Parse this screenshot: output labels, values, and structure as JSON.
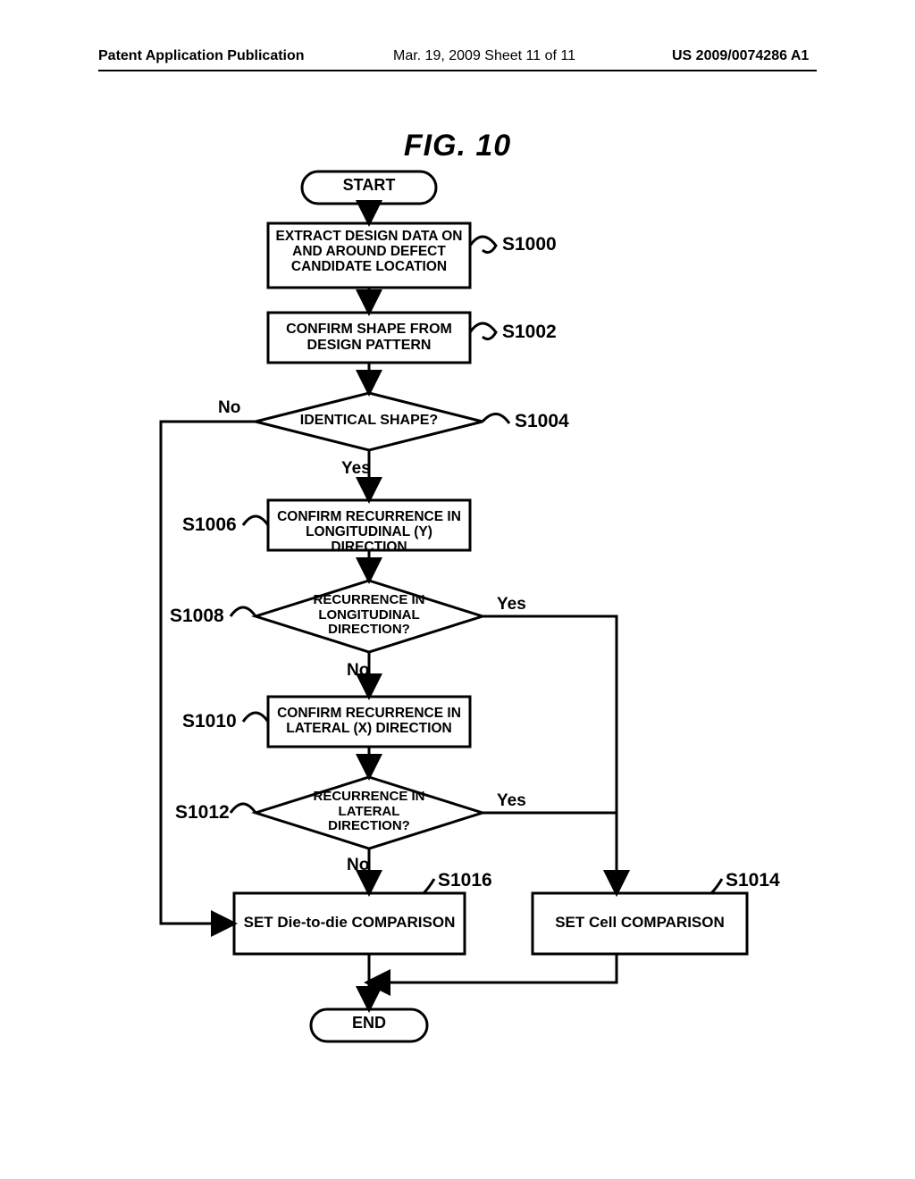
{
  "header": {
    "left": "Patent Application Publication",
    "mid": "Mar. 19, 2009  Sheet 11 of 11",
    "right": "US 2009/0074286 A1"
  },
  "figure_title": "FIG. 10",
  "nodes": {
    "start": "START",
    "s1000": "EXTRACT DESIGN DATA ON AND AROUND DEFECT CANDIDATE LOCATION",
    "s1002": "CONFIRM SHAPE FROM DESIGN PATTERN",
    "s1004": "IDENTICAL SHAPE?",
    "s1006": "CONFIRM RECURRENCE IN LONGITUDINAL (Y) DIRECTION",
    "s1008": "RECURRENCE IN LONGITUDINAL DIRECTION?",
    "s1010": "CONFIRM RECURRENCE IN LATERAL (X) DIRECTION",
    "s1012": "RECURRENCE IN LATERAL DIRECTION?",
    "s1016": "SET Die-to-die COMPARISON",
    "s1014": "SET Cell COMPARISON",
    "end": "END"
  },
  "step_labels": {
    "s1000": "S1000",
    "s1002": "S1002",
    "s1004": "S1004",
    "s1006": "S1006",
    "s1008": "S1008",
    "s1010": "S1010",
    "s1012": "S1012",
    "s1016": "S1016",
    "s1014": "S1014"
  },
  "edge_labels": {
    "s1004_no": "No",
    "s1004_yes": "Yes",
    "s1008_no": "No",
    "s1008_yes": "Yes",
    "s1012_no": "No",
    "s1012_yes": "Yes"
  },
  "chart_data": {
    "type": "flowchart",
    "title": "FIG. 10",
    "nodes": [
      {
        "id": "start",
        "type": "terminator",
        "label": "START"
      },
      {
        "id": "S1000",
        "type": "process",
        "label": "EXTRACT DESIGN DATA ON AND AROUND DEFECT CANDIDATE LOCATION"
      },
      {
        "id": "S1002",
        "type": "process",
        "label": "CONFIRM SHAPE FROM DESIGN PATTERN"
      },
      {
        "id": "S1004",
        "type": "decision",
        "label": "IDENTICAL SHAPE?"
      },
      {
        "id": "S1006",
        "type": "process",
        "label": "CONFIRM RECURRENCE IN LONGITUDINAL (Y) DIRECTION"
      },
      {
        "id": "S1008",
        "type": "decision",
        "label": "RECURRENCE IN LONGITUDINAL DIRECTION?"
      },
      {
        "id": "S1010",
        "type": "process",
        "label": "CONFIRM RECURRENCE IN LATERAL (X) DIRECTION"
      },
      {
        "id": "S1012",
        "type": "decision",
        "label": "RECURRENCE IN LATERAL DIRECTION?"
      },
      {
        "id": "S1016",
        "type": "process",
        "label": "SET Die-to-die COMPARISON"
      },
      {
        "id": "S1014",
        "type": "process",
        "label": "SET Cell COMPARISON"
      },
      {
        "id": "end",
        "type": "terminator",
        "label": "END"
      }
    ],
    "edges": [
      {
        "from": "start",
        "to": "S1000"
      },
      {
        "from": "S1000",
        "to": "S1002"
      },
      {
        "from": "S1002",
        "to": "S1004"
      },
      {
        "from": "S1004",
        "to": "S1006",
        "label": "Yes"
      },
      {
        "from": "S1004",
        "to": "S1016",
        "label": "No"
      },
      {
        "from": "S1006",
        "to": "S1008"
      },
      {
        "from": "S1008",
        "to": "S1010",
        "label": "No"
      },
      {
        "from": "S1008",
        "to": "S1014",
        "label": "Yes"
      },
      {
        "from": "S1010",
        "to": "S1012"
      },
      {
        "from": "S1012",
        "to": "S1016",
        "label": "No"
      },
      {
        "from": "S1012",
        "to": "S1014",
        "label": "Yes"
      },
      {
        "from": "S1016",
        "to": "end"
      },
      {
        "from": "S1014",
        "to": "end"
      }
    ]
  }
}
